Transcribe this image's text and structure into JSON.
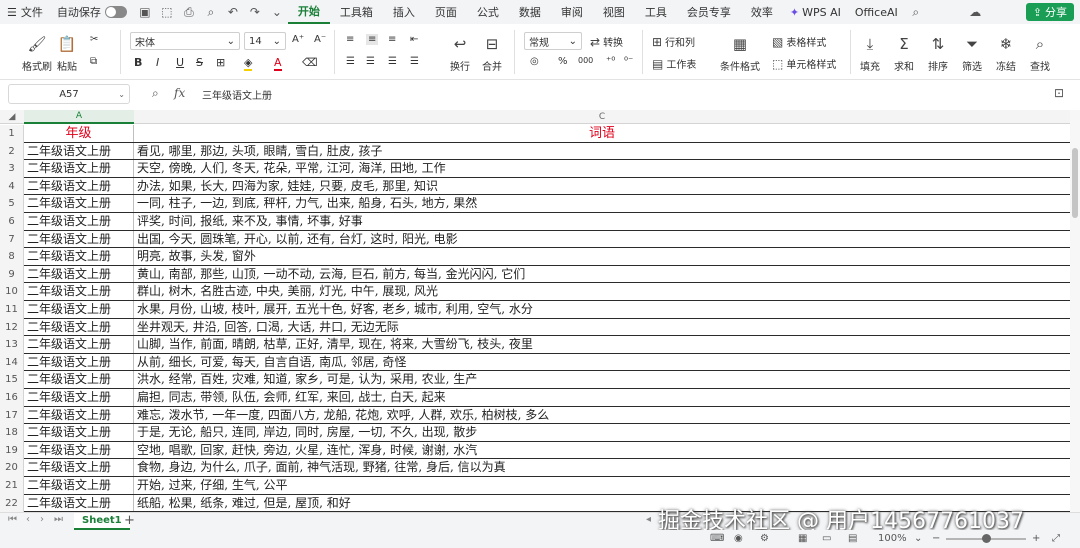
{
  "menubar": {
    "file": "文件",
    "autosave": "自动保存",
    "tabs": [
      "开始",
      "工具箱",
      "插入",
      "页面",
      "公式",
      "数据",
      "审阅",
      "视图",
      "工具",
      "会员专享",
      "效率"
    ],
    "wps_ai": "WPS AI",
    "office_ai": "OfficeAI",
    "share": "分享"
  },
  "ribbon": {
    "format_painter": "格式刷",
    "paste": "粘贴",
    "font_name": "宋体",
    "font_size": "14",
    "wrap": "换行",
    "merge": "合并",
    "number_format": "常规",
    "convert": "转换",
    "row_col": "行和列",
    "worksheet": "工作表",
    "cond_format": "条件格式",
    "table_style": "表格样式",
    "cell_style": "单元格样式",
    "fill": "填充",
    "sum": "求和",
    "sort": "排序",
    "filter": "筛选",
    "freeze": "冻结",
    "find": "查找",
    "bold": "B",
    "italic": "I",
    "underline": "U",
    "strike": "S",
    "font_color": "A",
    "percent": "%",
    "thousands": "000"
  },
  "formula_bar": {
    "cell_ref": "A57",
    "fx": "fx",
    "content": "三年级语文上册"
  },
  "grid": {
    "col_headers": [
      "A",
      "C"
    ],
    "header_row": {
      "num": "1",
      "a": "年级",
      "c": "词语"
    },
    "rows": [
      {
        "num": "2",
        "a": "二年级语文上册",
        "c": "看见, 哪里, 那边, 头项, 眼睛, 雪白, 肚皮, 孩子"
      },
      {
        "num": "3",
        "a": "二年级语文上册",
        "c": "天空, 傍晚, 人们, 冬天, 花朵, 平常, 江河, 海洋, 田地, 工作"
      },
      {
        "num": "4",
        "a": "二年级语文上册",
        "c": "办法, 如果, 长大, 四海为家, 娃娃, 只要, 皮毛, 那里, 知识"
      },
      {
        "num": "5",
        "a": "二年级语文上册",
        "c": "一同, 柱子, 一边, 到底, 秤杆, 力气, 出来, 船身, 石头, 地方, 果然"
      },
      {
        "num": "6",
        "a": "二年级语文上册",
        "c": "评奖, 时间, 报纸, 来不及, 事情, 坏事, 好事"
      },
      {
        "num": "7",
        "a": "二年级语文上册",
        "c": "出国, 今天, 圆珠笔, 开心, 以前, 还有, 台灯, 这时, 阳光, 电影"
      },
      {
        "num": "8",
        "a": "二年级语文上册",
        "c": "明亮, 故事, 头发, 窗外"
      },
      {
        "num": "9",
        "a": "二年级语文上册",
        "c": "黄山, 南部, 那些, 山顶, 一动不动, 云海, 巨石, 前方, 每当, 金光闪闪, 它们"
      },
      {
        "num": "10",
        "a": "二年级语文上册",
        "c": "群山, 树木, 名胜古迹, 中央, 美丽, 灯光, 中午, 展现, 风光"
      },
      {
        "num": "11",
        "a": "二年级语文上册",
        "c": "水果, 月份, 山坡, 枝叶, 展开, 五光十色, 好客, 老乡, 城市, 利用, 空气, 水分"
      },
      {
        "num": "12",
        "a": "二年级语文上册",
        "c": "坐井观天, 井沿, 回答, 口渴, 大话, 井口, 无边无际"
      },
      {
        "num": "13",
        "a": "二年级语文上册",
        "c": "山脚, 当作, 前面, 晴朗, 枯草, 正好, 清早, 现在, 将来, 大雪纷飞, 枝头, 夜里"
      },
      {
        "num": "14",
        "a": "二年级语文上册",
        "c": "从前, 细长, 可爱, 每天, 自言自语, 南瓜, 邻居, 奇怪"
      },
      {
        "num": "15",
        "a": "二年级语文上册",
        "c": "洪水, 经常, 百姓, 灾难, 知道, 家乡, 可是, 认为, 采用, 农业, 生产"
      },
      {
        "num": "16",
        "a": "二年级语文上册",
        "c": "扁担, 同志, 带领, 队伍, 会师, 红军, 来回, 战士, 白天, 起来"
      },
      {
        "num": "17",
        "a": "二年级语文上册",
        "c": "难忘, 泼水节, 一年一度, 四面八方, 龙船, 花炮, 欢呼, 人群, 欢乐, 柏树枝, 多么"
      },
      {
        "num": "18",
        "a": "二年级语文上册",
        "c": "于是, 无论, 船只, 连同, 岸边, 同时, 房屋, 一切, 不久, 出现, 散步"
      },
      {
        "num": "19",
        "a": "二年级语文上册",
        "c": "空地, 唱歌, 回家, 赶快, 旁边, 火星, 连忙, 浑身, 时候, 谢谢, 水汽"
      },
      {
        "num": "20",
        "a": "二年级语文上册",
        "c": "食物, 身边, 为什么, 爪子, 面前, 神气活现, 野猪, 往常, 身后, 信以为真"
      },
      {
        "num": "21",
        "a": "二年级语文上册",
        "c": "开始, 过来, 仔细, 生气, 公平"
      },
      {
        "num": "22",
        "a": "二年级语文上册",
        "c": "纸船, 松果, 纸条, 难过, 但是, 屋顶, 和好"
      }
    ]
  },
  "sheet_tabs": {
    "active": "Sheet1",
    "add": "+"
  },
  "status": {
    "zoom": "100%"
  },
  "watermark": "掘金技术社区 @ 用户14567761037",
  "colors": {
    "accent": "#1a7f37",
    "header_text": "#e0001b",
    "share_bg": "#1a9e55"
  }
}
